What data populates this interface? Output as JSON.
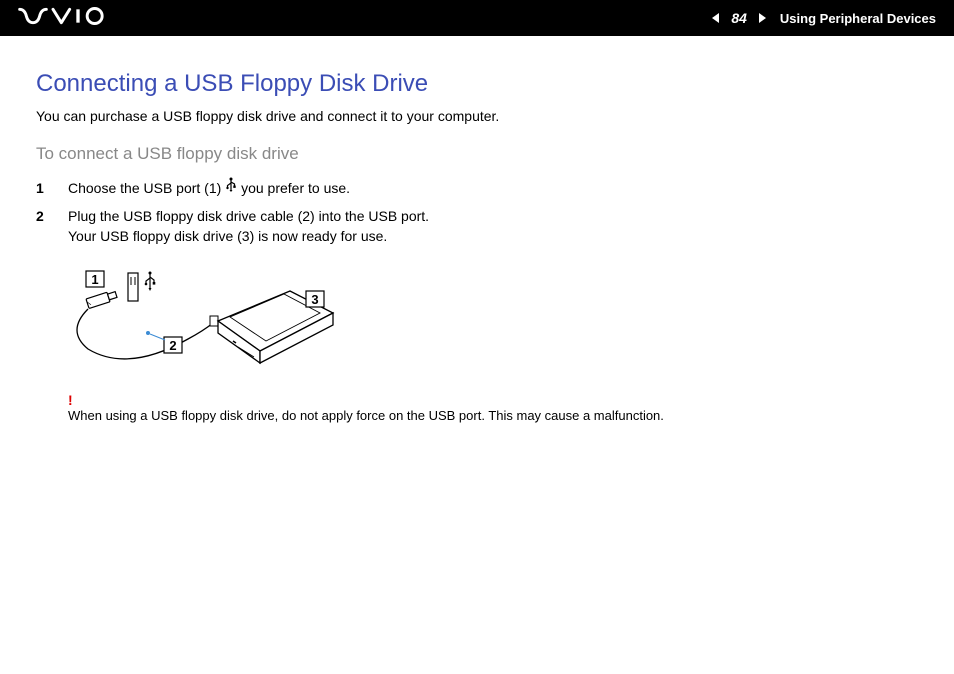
{
  "header": {
    "page_number": "84",
    "section": "Using Peripheral Devices"
  },
  "main": {
    "heading": "Connecting a USB Floppy Disk Drive",
    "intro": "You can purchase a USB floppy disk drive and connect it to your computer.",
    "sub_heading": "To connect a USB floppy disk drive",
    "steps": [
      {
        "text_before_icon": "Choose the USB port (1) ",
        "text_after_icon": " you prefer to use."
      },
      {
        "text_before_icon": "Plug the USB floppy disk drive cable (2) into the USB port.\nYour USB floppy disk drive (3) is now ready for use.",
        "text_after_icon": ""
      }
    ],
    "diagram_labels": {
      "label1": "1",
      "label2": "2",
      "label3": "3"
    },
    "warning": {
      "mark": "!",
      "text": "When using a USB floppy disk drive, do not apply force on the USB port. This may cause a malfunction."
    }
  }
}
